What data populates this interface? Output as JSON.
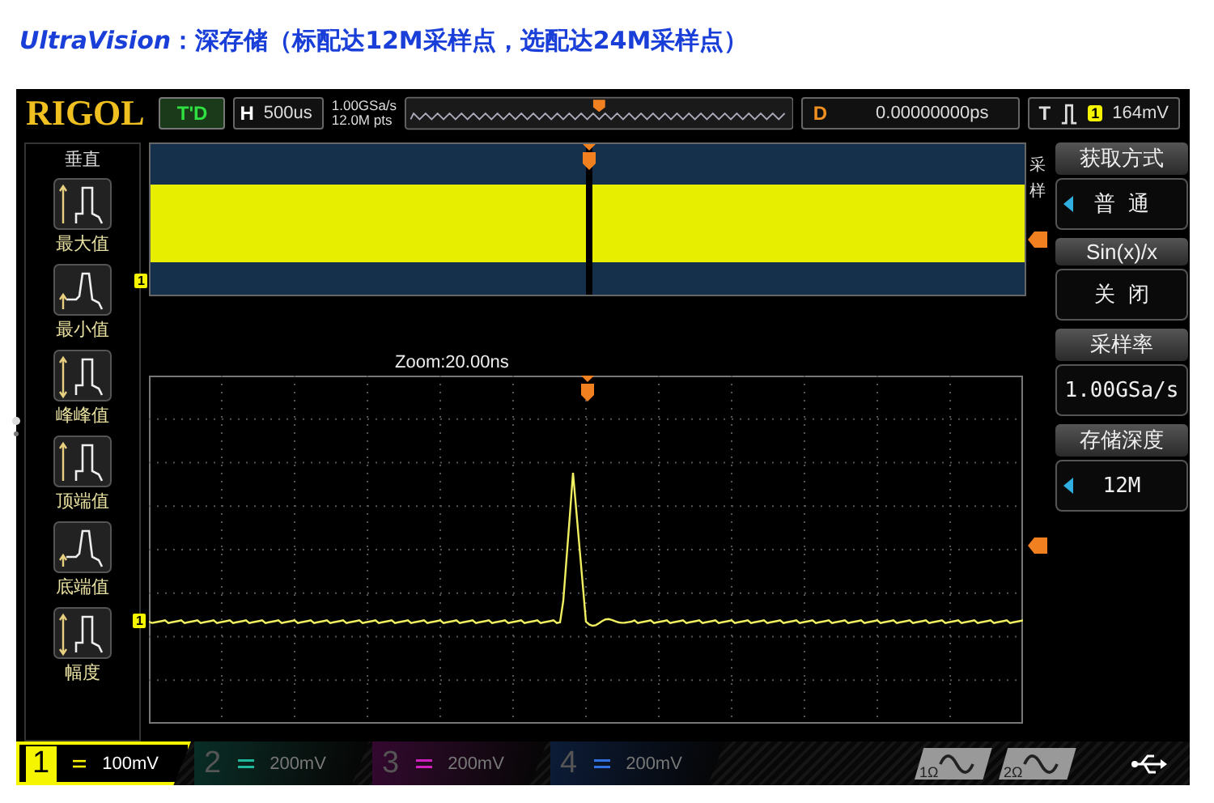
{
  "caption": "*UltraVision*：深存储（标配达12M采样点，选配达24M采样点）",
  "top_bar": {
    "logo": "RIGOL",
    "run_status": "T'D",
    "horizontal": {
      "label": "H",
      "value": "500us"
    },
    "sample_info": [
      "1.00GSa/s",
      "12.0M pts"
    ],
    "delay": {
      "label": "D",
      "value": "0.00000000ps"
    },
    "trigger": {
      "label": "T",
      "channel": "1",
      "level": "164mV"
    }
  },
  "left_menu": {
    "title": "垂直",
    "items": [
      {
        "label": "最大值",
        "kind": "max"
      },
      {
        "label": "最小值",
        "kind": "min"
      },
      {
        "label": "峰峰值",
        "kind": "peak"
      },
      {
        "label": "顶端值",
        "kind": "top"
      },
      {
        "label": "底端值",
        "kind": "base"
      },
      {
        "label": "幅度",
        "kind": "amplitude"
      }
    ]
  },
  "waveform": {
    "overview_marker": "1",
    "zoom_label": "Zoom:20.00ns",
    "main_marker": "1"
  },
  "side_label": "采样",
  "right_menu": [
    {
      "title": "获取方式",
      "value": "普 通",
      "kind": "select"
    },
    {
      "title": "Sin(x)/x",
      "value": "关 闭",
      "kind": "plain"
    },
    {
      "title": "采样率",
      "value": "1.00GSa/s",
      "kind": "plain"
    },
    {
      "title": "存储深度",
      "value": "12M",
      "kind": "select"
    }
  ],
  "channels": [
    {
      "number": "1",
      "scale": "100mV",
      "selected": true,
      "color": "#f5f500"
    },
    {
      "number": "2",
      "scale": "200mV",
      "selected": false,
      "color": "#1fb89a"
    },
    {
      "number": "3",
      "scale": "200mV",
      "selected": false,
      "color": "#d020c0"
    },
    {
      "number": "4",
      "scale": "200mV",
      "selected": false,
      "color": "#3070e0"
    }
  ],
  "generators": [
    {
      "number": "1",
      "unit": "Ω"
    },
    {
      "number": "2",
      "unit": "Ω"
    }
  ]
}
